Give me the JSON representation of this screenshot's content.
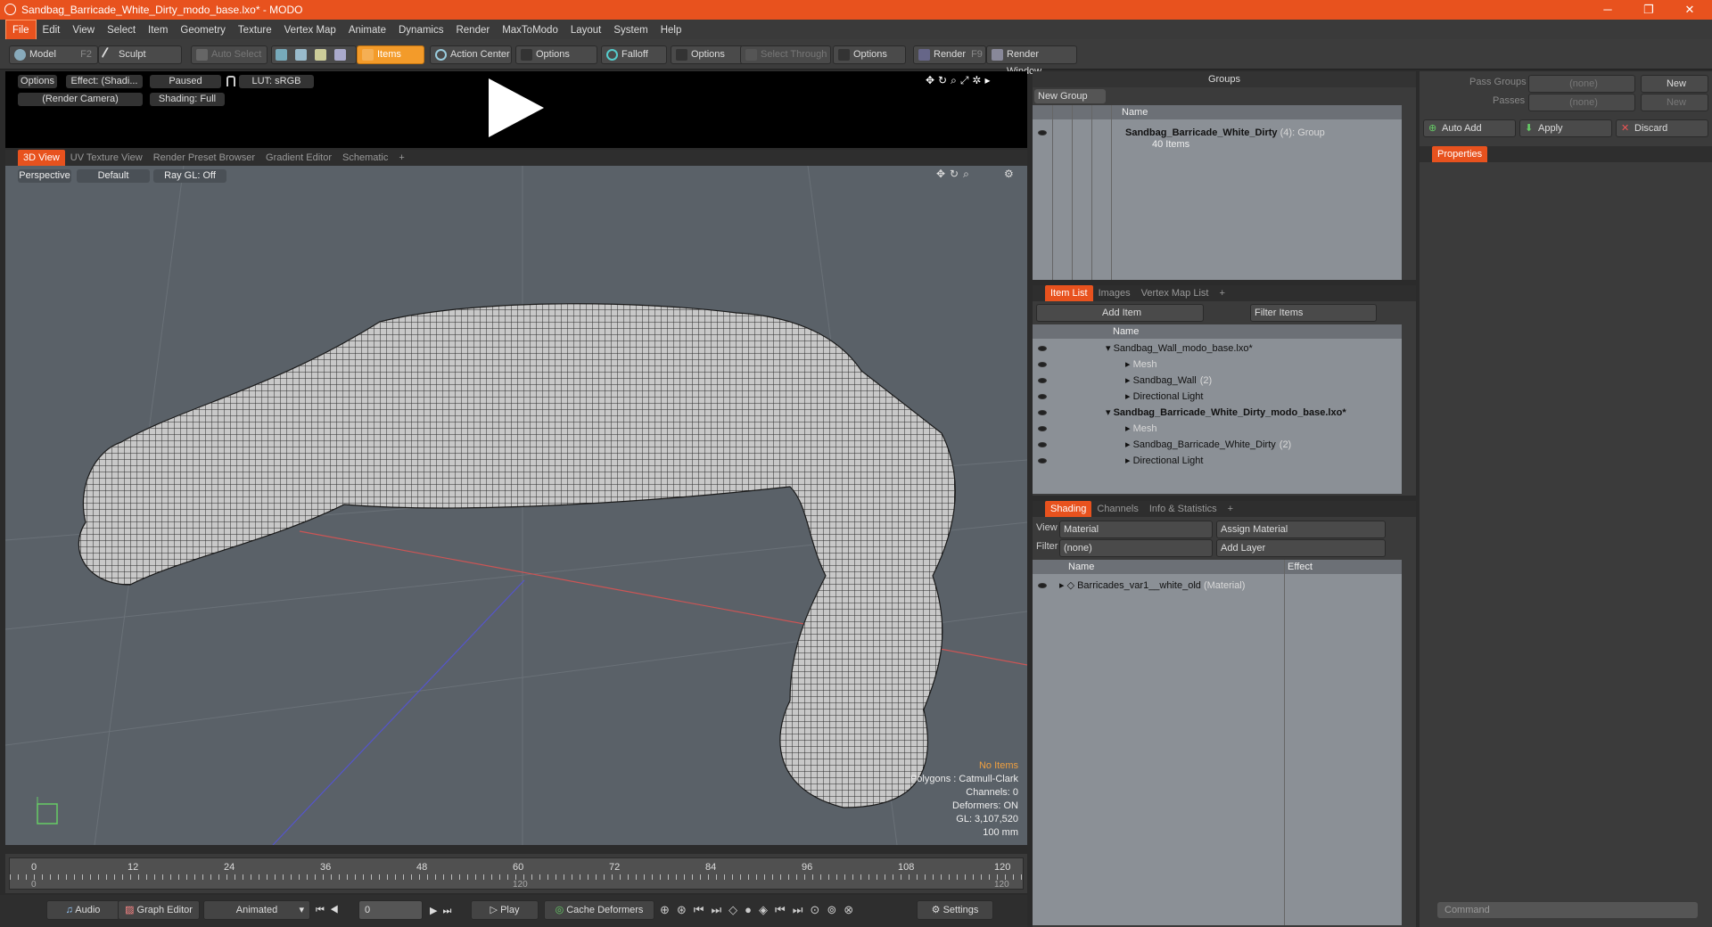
{
  "titlebar": {
    "title": "Sandbag_Barricade_White_Dirty_modo_base.lxo* - MODO",
    "minimize": "─",
    "restore": "❐",
    "close": "✕"
  },
  "menu": [
    "File",
    "Edit",
    "View",
    "Select",
    "Item",
    "Geometry",
    "Texture",
    "Vertex Map",
    "Animate",
    "Dynamics",
    "Render",
    "MaxToModo",
    "Layout",
    "System",
    "Help"
  ],
  "toolbar": {
    "model": "Model",
    "model_key": "F2",
    "sculpt": "Sculpt",
    "auto_select": "Auto Select",
    "items": "Items",
    "action_center": "Action Center",
    "options1": "Options",
    "falloff": "Falloff",
    "options2": "Options",
    "select_through": "Select Through",
    "options3": "Options",
    "render": "Render",
    "render_key": "F9",
    "render_window": "Render Window"
  },
  "preview": {
    "options": "Options",
    "effect": "Effect: (Shadi...",
    "paused": "Paused",
    "lut": "LUT: sRGB",
    "camera": "(Render Camera)",
    "shading": "Shading: Full"
  },
  "viewport_tabs": [
    "3D View",
    "UV Texture View",
    "Render Preset Browser",
    "Gradient Editor",
    "Schematic",
    "+"
  ],
  "viewport": {
    "perspective": "Perspective",
    "default": "Default",
    "raygl": "Ray GL: Off",
    "stats": [
      "No Items",
      "Polygons : Catmull-Clark",
      "Channels: 0",
      "Deformers: ON",
      "GL: 3,107,520",
      "100 mm"
    ]
  },
  "timeline": {
    "ticks": [
      "0",
      "12",
      "24",
      "36",
      "48",
      "60",
      "72",
      "84",
      "96",
      "108",
      "120"
    ],
    "low": [
      "0",
      "120",
      "120"
    ]
  },
  "bottombar": {
    "audio": "Audio",
    "graph_editor": "Graph Editor",
    "animated": "Animated",
    "frame": "0",
    "play": "Play",
    "cache": "Cache Deformers",
    "settings": "Settings"
  },
  "groups": {
    "title": "Groups",
    "new_group": "New Group",
    "col_name": "Name",
    "item_name": "Sandbag_Barricade_White_Dirty",
    "item_count": "(4)",
    "item_type": ": Group",
    "item_sub": "40 Items"
  },
  "pass": {
    "pass_groups": "Pass Groups",
    "passes": "Passes",
    "none1": "(none)",
    "none2": "(none)",
    "new1": "New",
    "new2": "New",
    "auto_add": "Auto Add",
    "apply": "Apply",
    "discard": "Discard",
    "properties": "Properties",
    "command": "Command"
  },
  "itemlist": {
    "tabs": [
      "Item List",
      "Images",
      "Vertex Map List",
      "+"
    ],
    "add_item": "Add Item",
    "filter": "Filter Items",
    "col_name": "Name",
    "rows": [
      {
        "label": "Sandbag_Wall_modo_base.lxo*",
        "indent": 0,
        "bold": false,
        "dim": false,
        "suffix": ""
      },
      {
        "label": "Mesh",
        "indent": 1,
        "bold": false,
        "dim": true,
        "suffix": ""
      },
      {
        "label": "Sandbag_Wall",
        "indent": 1,
        "bold": false,
        "dim": false,
        "suffix": "(2)"
      },
      {
        "label": "Directional Light",
        "indent": 1,
        "bold": false,
        "dim": false,
        "suffix": ""
      },
      {
        "label": "Sandbag_Barricade_White_Dirty_modo_base.lxo*",
        "indent": 0,
        "bold": true,
        "dim": false,
        "suffix": ""
      },
      {
        "label": "Mesh",
        "indent": 1,
        "bold": false,
        "dim": true,
        "suffix": ""
      },
      {
        "label": "Sandbag_Barricade_White_Dirty",
        "indent": 1,
        "bold": false,
        "dim": false,
        "suffix": "(2)"
      },
      {
        "label": "Directional Light",
        "indent": 1,
        "bold": false,
        "dim": false,
        "suffix": ""
      }
    ]
  },
  "shading": {
    "tabs": [
      "Shading",
      "Channels",
      "Info & Statistics",
      "+"
    ],
    "view_label": "View",
    "view_value": "Material",
    "assign": "Assign Material",
    "filter_label": "Filter",
    "filter_value": "(none)",
    "add_layer": "Add Layer",
    "col_name": "Name",
    "col_effect": "Effect",
    "row_name": "Barricades_var1__white_old",
    "row_type": "(Material)"
  }
}
